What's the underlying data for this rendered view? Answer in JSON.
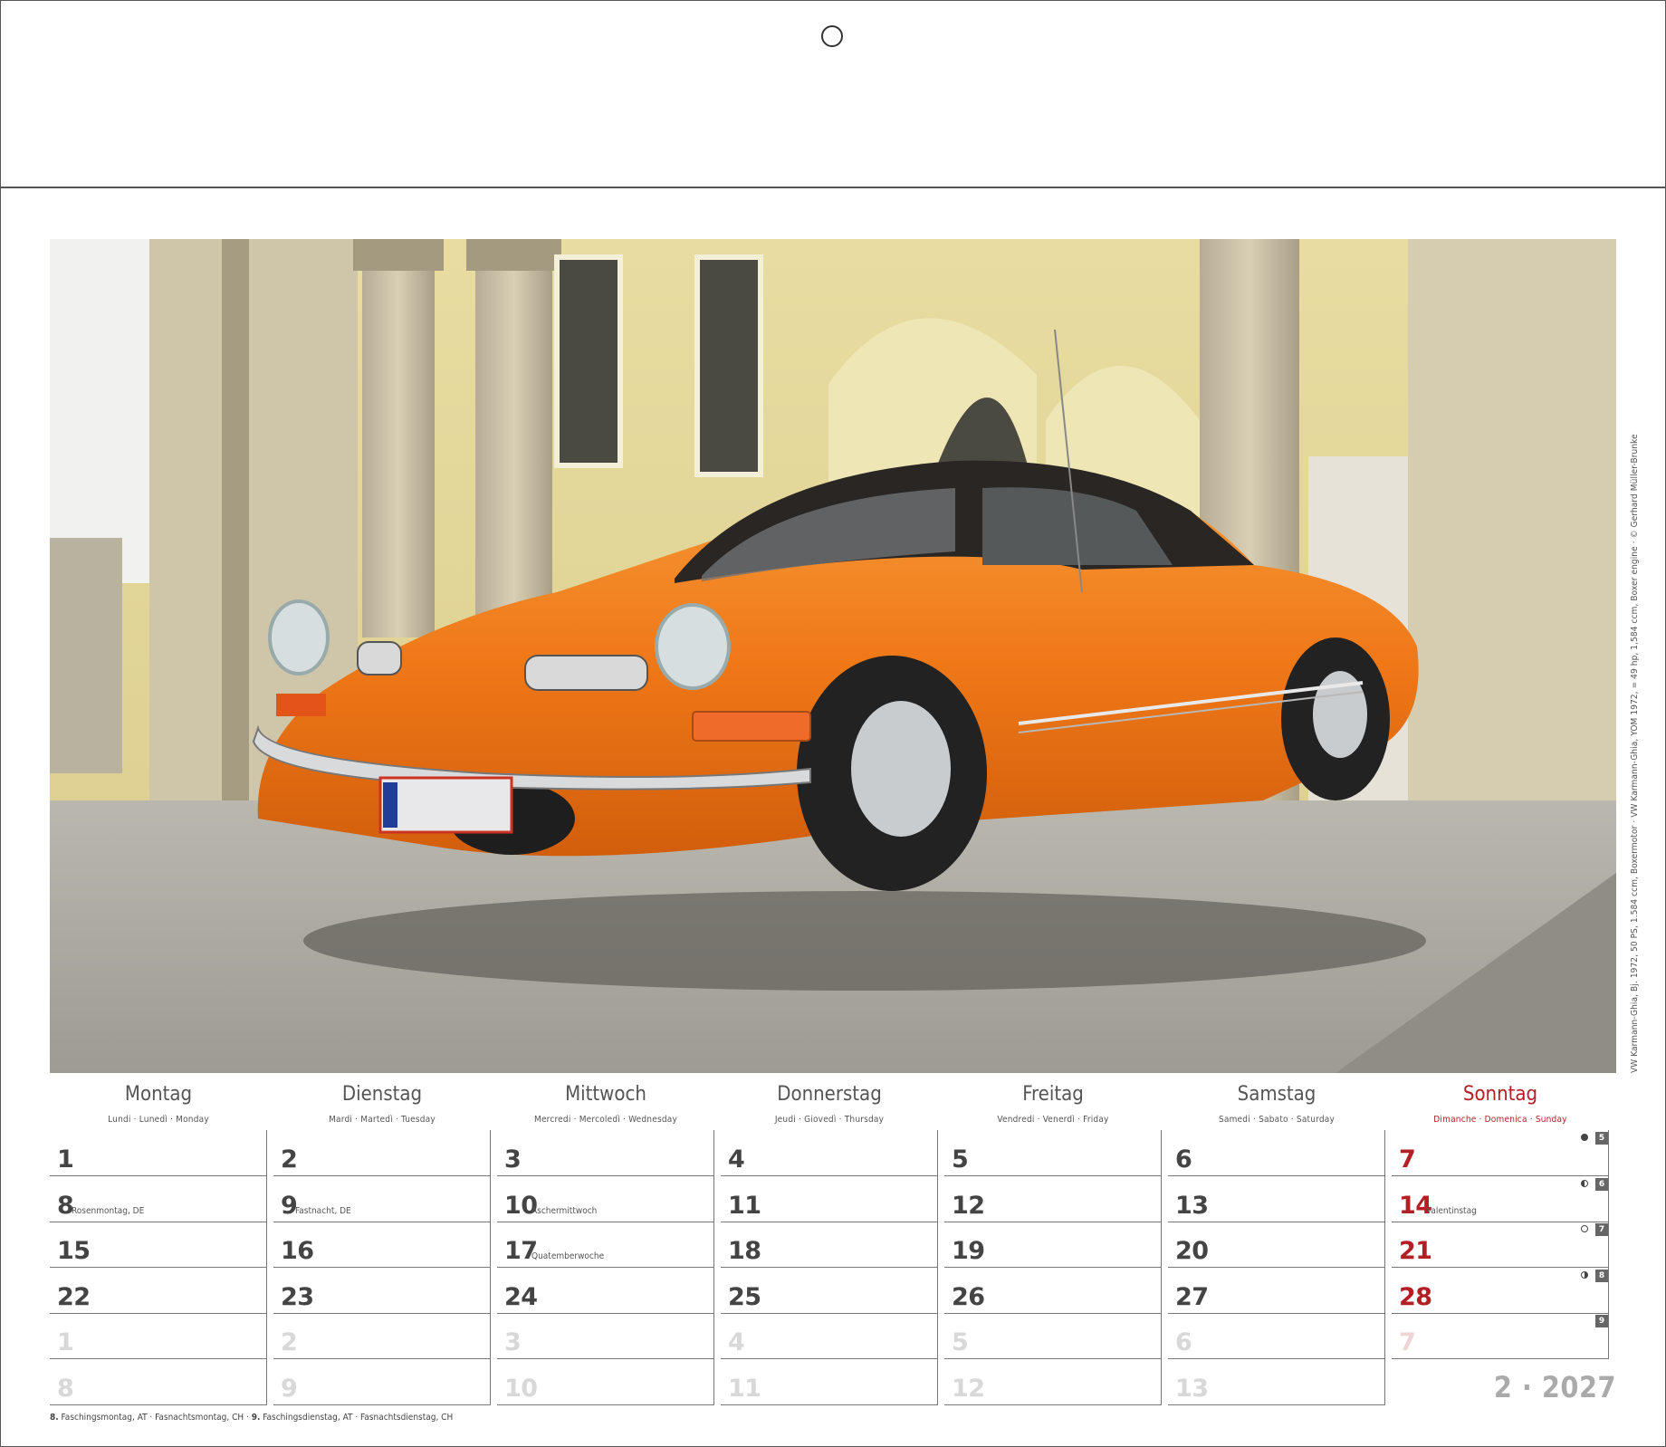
{
  "photo": {
    "credit": "VW Karmann-Ghia, Bj. 1972, 50 PS, 1.584 ccm, Boxermotor · VW Karmann-Ghia, YOM 1972, = 49 hp, 1,584 ccm, Boxer engine · © Gerhard Müller-Brunke",
    "license_plate_country": "D",
    "car_color": "#f07a1a"
  },
  "weekdays": [
    {
      "name": "Montag",
      "sub": "Lundi · Lunedì · Monday"
    },
    {
      "name": "Dienstag",
      "sub": "Mardi · Martedì · Tuesday"
    },
    {
      "name": "Mittwoch",
      "sub": "Mercredi · Mercoledì · Wednesday"
    },
    {
      "name": "Donnerstag",
      "sub": "Jeudi · Giovedì · Thursday"
    },
    {
      "name": "Freitag",
      "sub": "Vendredi · Venerdì · Friday"
    },
    {
      "name": "Samstag",
      "sub": "Samedi · Sabato · Saturday"
    },
    {
      "name": "Sonntag",
      "sub": "Dimanche · Domenica · Sunday"
    }
  ],
  "weeks": [
    {
      "days": [
        "1",
        "2",
        "3",
        "4",
        "5",
        "6",
        "7"
      ],
      "notes": [
        "",
        "",
        "",
        "",
        "",
        "",
        ""
      ],
      "week_no": "5",
      "moon": "full"
    },
    {
      "days": [
        "8",
        "9",
        "10",
        "11",
        "12",
        "13",
        "14"
      ],
      "notes": [
        "Rosenmontag, DE",
        "Fastnacht, DE",
        "Aschermittwoch",
        "",
        "",
        "",
        "Valentinstag"
      ],
      "week_no": "6",
      "moon": "last"
    },
    {
      "days": [
        "15",
        "16",
        "17",
        "18",
        "19",
        "20",
        "21"
      ],
      "notes": [
        "",
        "",
        "Quatemberwoche",
        "",
        "",
        "",
        ""
      ],
      "week_no": "7",
      "moon": "new"
    },
    {
      "days": [
        "22",
        "23",
        "24",
        "25",
        "26",
        "27",
        "28"
      ],
      "notes": [
        "",
        "",
        "",
        "",
        "",
        "",
        ""
      ],
      "week_no": "8",
      "moon": "first"
    },
    {
      "days": [
        "1",
        "2",
        "3",
        "4",
        "5",
        "6",
        "7"
      ],
      "notes": [
        "",
        "",
        "",
        "",
        "",
        "",
        ""
      ],
      "week_no": "9",
      "moon": "",
      "faded": true
    },
    {
      "days": [
        "8",
        "9",
        "10",
        "11",
        "12",
        "13",
        ""
      ],
      "notes": [
        "",
        "",
        "",
        "",
        "",
        "",
        ""
      ],
      "week_no": "",
      "moon": "",
      "faded": true
    }
  ],
  "month_year": "2 · 2027",
  "footnote": {
    "bold1": "8.",
    "text1": " Faschingsmontag, AT · Fasnachtsmontag, CH · ",
    "bold2": "9.",
    "text2": " Faschingsdienstag, AT · Fasnachtsdienstag, CH"
  },
  "colors": {
    "sunday": "#b21f24",
    "text": "#444444",
    "faded": "#d8d8d8",
    "week_badge": "#666666"
  }
}
